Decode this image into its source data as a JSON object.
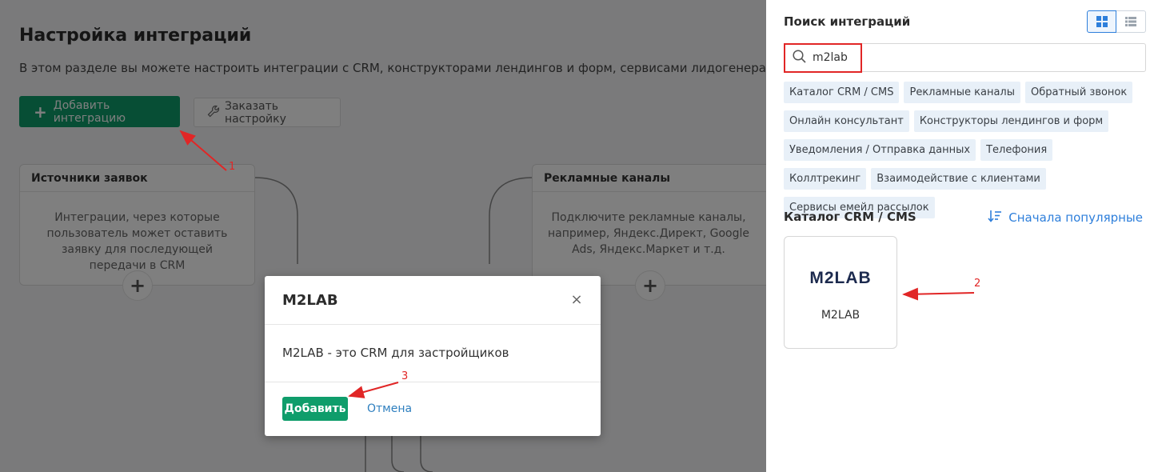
{
  "main": {
    "title": "Настройка интеграций",
    "description": "В этом разделе вы можете настроить интеграции с CRM, конструкторами лендингов и форм, сервисами лидогенерации, с",
    "add_button": "Добавить интеграцию",
    "order_button": "Заказать настройку",
    "cards": [
      {
        "title": "Источники заявок",
        "text": "Интеграции, через которые пользователь может оставить заявку для последующей передачи в CRM"
      },
      {
        "title": "Рекламные каналы",
        "text": "Подключите рекламные каналы, например, Яндекс.Директ, Google Ads, Яндекс.Маркет и т.д."
      }
    ]
  },
  "modal": {
    "title": "M2LAB",
    "body": "M2LAB - это CRM для застройщиков",
    "add_button": "Добавить",
    "cancel_link": "Отмена"
  },
  "panel": {
    "title": "Поиск интеграций",
    "search_value": "m2lab",
    "view_modes": [
      "grid-view-icon",
      "list-view-icon"
    ],
    "active_view": "grid",
    "tags": [
      "Каталог CRM / CMS",
      "Рекламные каналы",
      "Обратный звонок",
      "Онлайн консультант",
      "Конструкторы лендингов и форм",
      "Уведомления / Отправка данных",
      "Телефония",
      "Коллтрекинг",
      "Взаимодействие с клиентами",
      "Сервисы емейл рассылок"
    ],
    "catalog_title": "Каталог CRM / CMS",
    "sort_label": "Сначала популярные",
    "results": [
      {
        "logo_text": "M2LAB",
        "name": "M2LAB"
      }
    ]
  },
  "annotations": [
    "1",
    "2",
    "3"
  ],
  "colors": {
    "primary_green": "#0f9d6b",
    "link_blue": "#2e7fdb",
    "annotation_red": "#e12626",
    "tag_bg": "#e8f0f8"
  }
}
